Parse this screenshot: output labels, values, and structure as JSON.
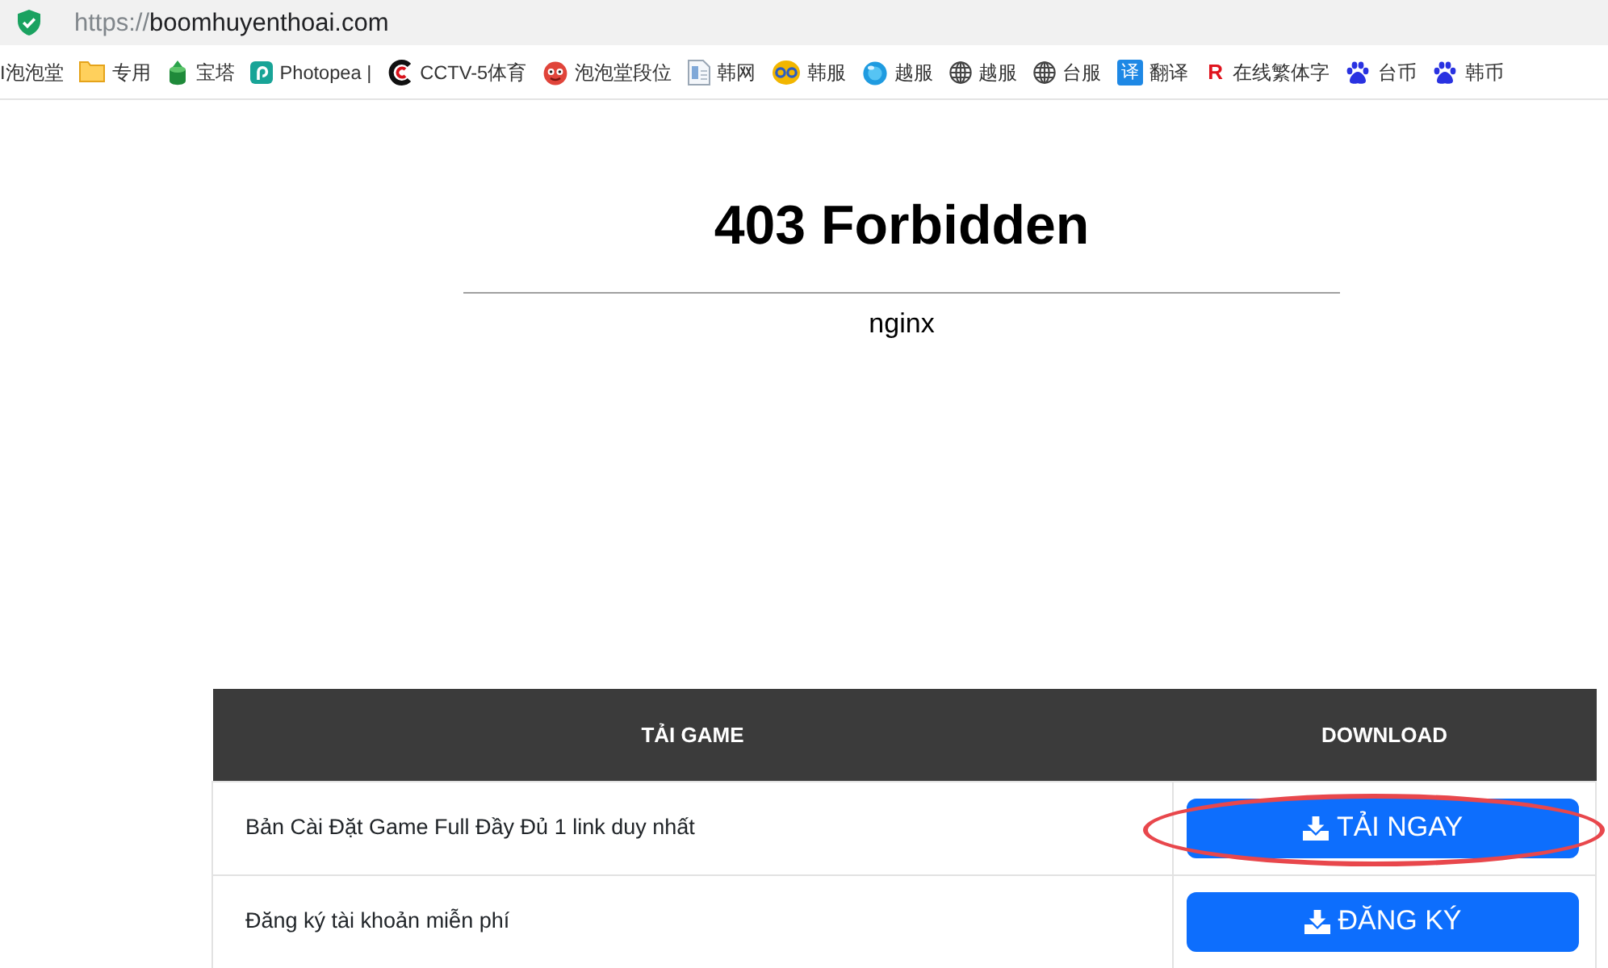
{
  "address_bar": {
    "scheme": "https://",
    "host": "boomhuyenthoai.com"
  },
  "bookmarks": [
    {
      "kind": "plain",
      "label": "I泡泡堂"
    },
    {
      "kind": "folder",
      "label": "专用"
    },
    {
      "kind": "cylinder",
      "label": "宝塔"
    },
    {
      "kind": "spiral-tile",
      "label": "Photopea |"
    },
    {
      "kind": "arcs",
      "label": "CCTV-5体育"
    },
    {
      "kind": "cartoon-face",
      "label": "泡泡堂段位"
    },
    {
      "kind": "document",
      "label": "韩网"
    },
    {
      "kind": "emblem",
      "label": "韩服"
    },
    {
      "kind": "ball",
      "label": "越服"
    },
    {
      "kind": "globe",
      "label": "越服"
    },
    {
      "kind": "globe",
      "label": "台服"
    },
    {
      "kind": "char-tile",
      "icon_char": "译",
      "label": "翻译"
    },
    {
      "kind": "char",
      "icon_char": "R",
      "label": "在线繁体字"
    },
    {
      "kind": "paw",
      "label": "台币"
    },
    {
      "kind": "paw",
      "label": "韩币"
    }
  ],
  "page": {
    "heading": "403 Forbidden",
    "server": "nginx"
  },
  "table": {
    "columns": [
      "TẢI GAME",
      "DOWNLOAD"
    ],
    "rows": [
      {
        "text": "Bản Cài Đặt Game Full Đầy Đủ 1 link duy nhất",
        "button": "TẢI NGAY",
        "circled": true
      },
      {
        "text": "Đăng ký tài khoản miễn phí",
        "button": "ĐĂNG KÝ",
        "circled": false
      }
    ]
  }
}
